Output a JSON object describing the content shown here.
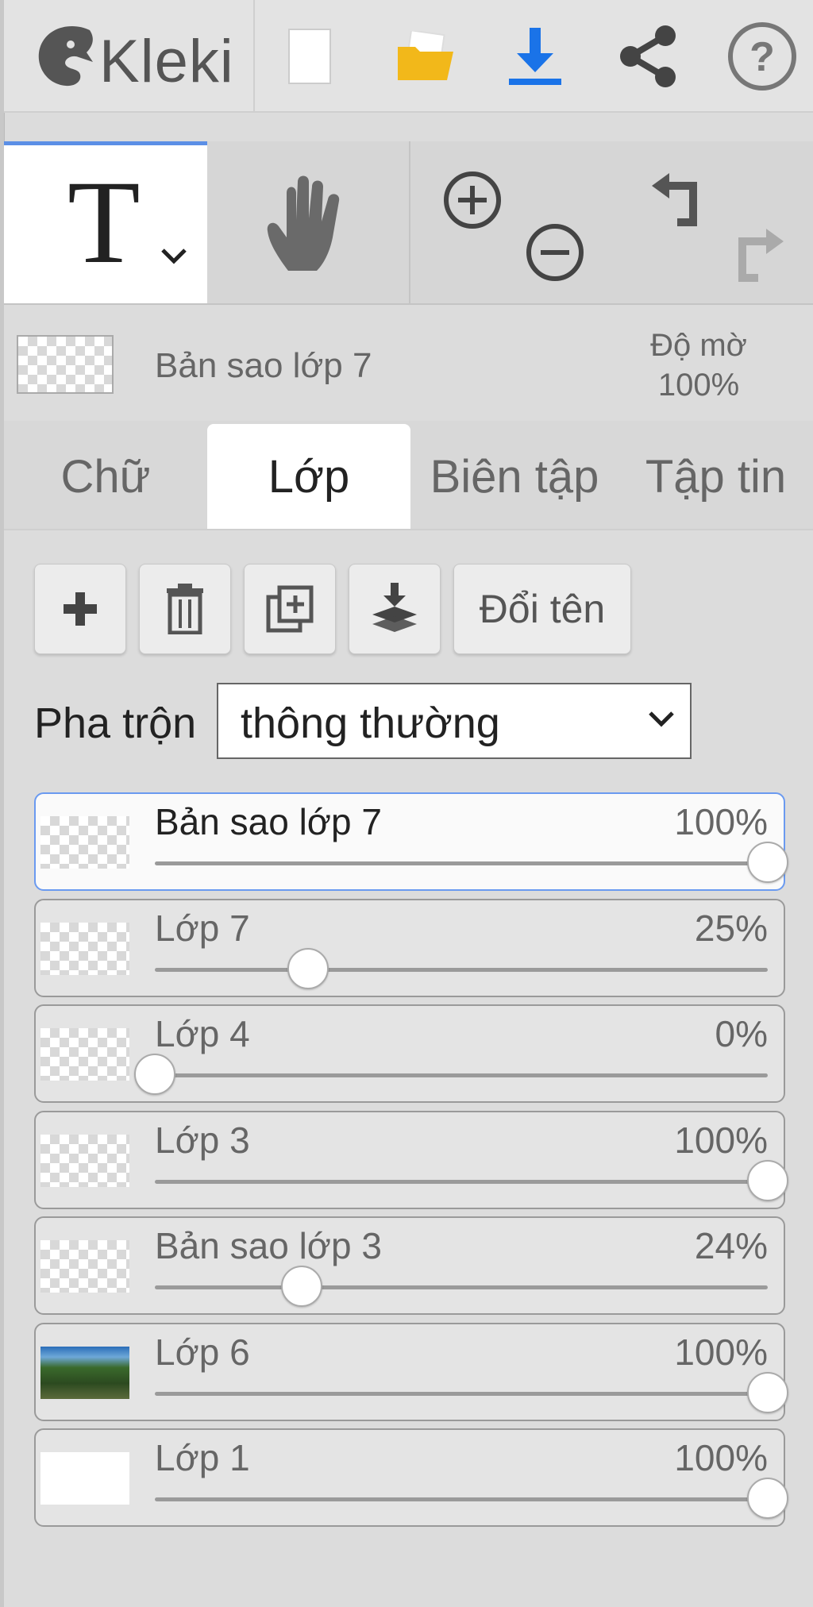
{
  "app": {
    "name": "Kleki"
  },
  "info": {
    "layer_name": "Bản sao lớp 7",
    "opacity_label": "Độ mờ",
    "opacity_value": "100%"
  },
  "tabs": [
    {
      "label": "Chữ",
      "active": false
    },
    {
      "label": "Lớp",
      "active": true
    },
    {
      "label": "Biên tập",
      "active": false
    },
    {
      "label": "Tập tin",
      "active": false
    }
  ],
  "actions": {
    "rename_label": "Đổi tên"
  },
  "blend": {
    "label": "Pha trộn",
    "value": "thông thường"
  },
  "layers": [
    {
      "name": "Bản sao lớp 7",
      "percent": "100%",
      "opacity": 1.0,
      "active": true,
      "thumb": "checker"
    },
    {
      "name": "Lớp 7",
      "percent": "25%",
      "opacity": 0.25,
      "active": false,
      "thumb": "checker"
    },
    {
      "name": "Lớp 4",
      "percent": "0%",
      "opacity": 0.0,
      "active": false,
      "thumb": "checker"
    },
    {
      "name": "Lớp 3",
      "percent": "100%",
      "opacity": 1.0,
      "active": false,
      "thumb": "checker"
    },
    {
      "name": "Bản sao lớp 3",
      "percent": "24%",
      "opacity": 0.24,
      "active": false,
      "thumb": "checker"
    },
    {
      "name": "Lớp 6",
      "percent": "100%",
      "opacity": 1.0,
      "active": false,
      "thumb": "photo"
    },
    {
      "name": "Lớp 1",
      "percent": "100%",
      "opacity": 1.0,
      "active": false,
      "thumb": "white"
    }
  ],
  "colors": {
    "accent": "#5b8fe6",
    "download": "#1a73e8",
    "folder": "#f2b81a"
  }
}
